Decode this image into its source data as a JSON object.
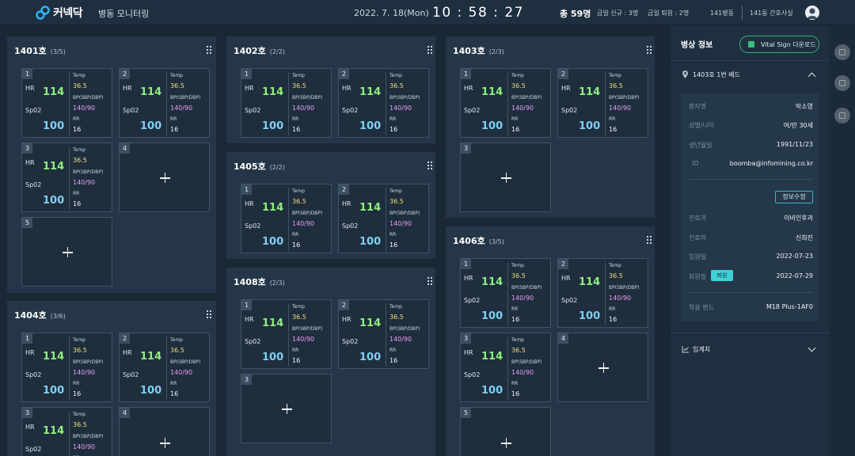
{
  "header": {
    "logo_text": "커넥닥",
    "app_title": "병동 모니터링",
    "date": "2022. 7. 18(Mon)",
    "time": "10 : 58 : 27",
    "total": "총 59명",
    "today_new": "금일 신규 : 3명",
    "today_discharged": "금일 퇴원 : 2명",
    "ward": "141병동",
    "station": "141동 간호사실",
    "accent_color": "#2fb3f2"
  },
  "labels": {
    "hr": "HR",
    "spo2": "Sp02",
    "temp": "Temp",
    "bp": "BP(SBP/DBP)",
    "rr": "RR"
  },
  "vitals": {
    "hr": "114",
    "spo2": "100",
    "temp": "36.5",
    "bp": "140/90",
    "rr": "16"
  },
  "rooms": {
    "r1401": {
      "name": "1401호",
      "count": "(3/5)",
      "beds": [
        "1",
        "2",
        "3",
        "4",
        "5"
      ]
    },
    "r1404": {
      "name": "1404호",
      "count": "(3/6)",
      "beds": [
        "1",
        "2",
        "3",
        "4"
      ]
    },
    "r1402": {
      "name": "1402호",
      "count": "(2/2)",
      "beds": [
        "1",
        "2"
      ]
    },
    "r1405": {
      "name": "1405호",
      "count": "(2/2)",
      "beds": [
        "1",
        "2"
      ]
    },
    "r1408": {
      "name": "1408호",
      "count": "(2/3)",
      "beds": [
        "1",
        "2",
        "3"
      ]
    },
    "r1403": {
      "name": "1403호",
      "count": "(2/3)",
      "beds": [
        "1",
        "2",
        "3"
      ]
    },
    "r1406": {
      "name": "1406호",
      "count": "(3/5)",
      "beds": [
        "1",
        "2",
        "3",
        "4",
        "5"
      ]
    }
  },
  "panel": {
    "title": "병상 정보",
    "download_label": "Vital Sign 다운로드",
    "bed_label": "1403호 1번 베드",
    "info": {
      "name_k": "환자명",
      "name_v": "박소영",
      "sexage_k": "성별/나이",
      "sexage_v": "여/만 30세",
      "birth_k": "생년월일",
      "birth_v": "1991/11/23",
      "id_k": "ID",
      "id_v": "boomba@infomining.co.kr",
      "edit_label": "정보수정",
      "dept_k": "진료과",
      "dept_v": "이비인후과",
      "doctor_k": "진료의",
      "doctor_v": "신희진",
      "admit_k": "입원일",
      "admit_v": "2022-07-23",
      "discharge_k": "퇴원일",
      "discharge_badge": "퇴원",
      "discharge_v": "2022-07-29",
      "band_k": "착용 밴드",
      "band_v": "M18 Plus-1AF0"
    },
    "critical_label": "임계치"
  }
}
